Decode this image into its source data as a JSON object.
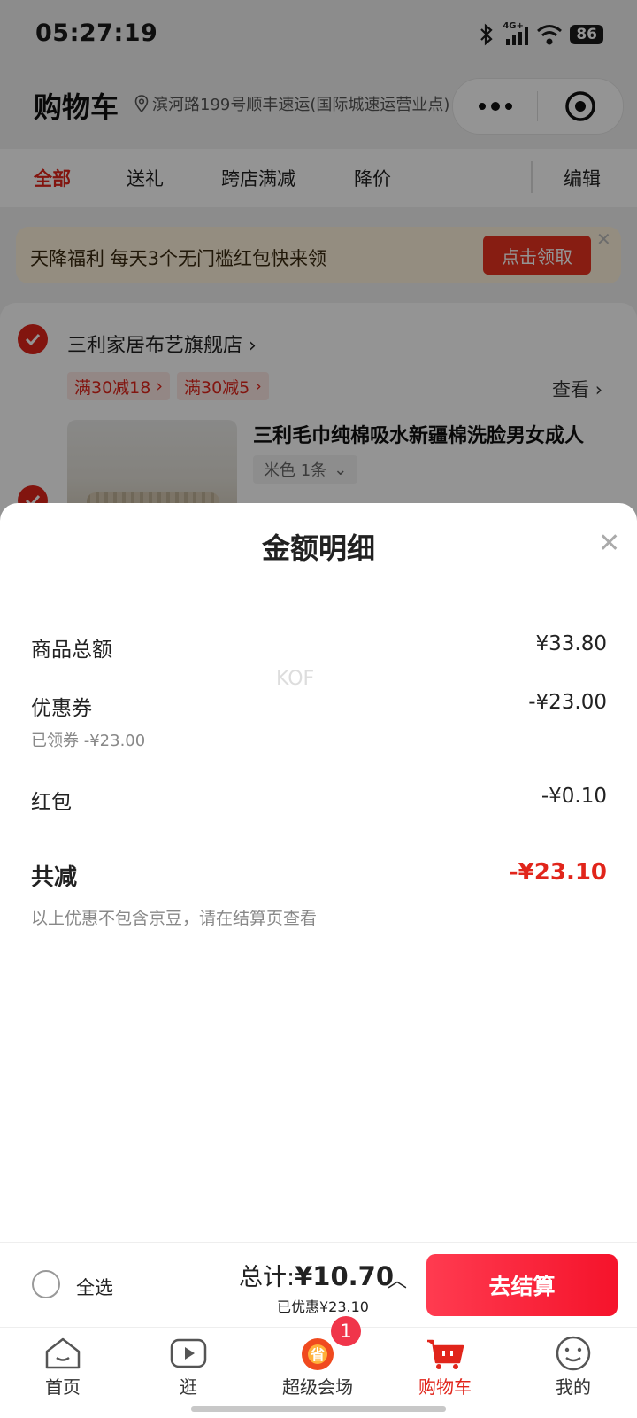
{
  "status_bar": {
    "time": "05:27:19",
    "battery": "86",
    "network": "4G+"
  },
  "header": {
    "title": "购物车",
    "location": "滨河路199号顺丰速运(国际城速运营业点)"
  },
  "tabs": [
    {
      "label": "全部",
      "active": true
    },
    {
      "label": "送礼"
    },
    {
      "label": "跨店满减"
    },
    {
      "label": "降价"
    }
  ],
  "edit_label": "编辑",
  "banner": {
    "text": "天降福利 每天3个无门槛红包快来领",
    "button": "点击领取"
  },
  "shop": {
    "name": "三利家居布艺旗舰店",
    "promos": [
      "满30减18",
      "满30减5"
    ],
    "view": "查看",
    "product": {
      "title": "三利毛巾纯棉吸水新疆棉洗脸男女成人",
      "sku": "米色 1条"
    }
  },
  "sheet": {
    "title": "金额明细",
    "watermark": "KOF",
    "rows": [
      {
        "label": "商品总额",
        "value": "¥33.80"
      },
      {
        "label": "优惠券",
        "value": "-¥23.00",
        "sub": "已领券 -¥23.00"
      },
      {
        "label": "红包",
        "value": "-¥0.10"
      }
    ],
    "total_label": "共减",
    "total_value": "-¥23.10",
    "note": "以上优惠不包含京豆，请在结算页查看"
  },
  "checkout": {
    "select_all": "全选",
    "total_prefix": "总计:",
    "total_amount": "¥10.70",
    "saved": "已优惠¥23.10",
    "button": "去结算"
  },
  "bottom_nav": [
    {
      "label": "首页"
    },
    {
      "label": "逛"
    },
    {
      "label": "超级会场",
      "badge": "1"
    },
    {
      "label": "购物车",
      "active": true
    },
    {
      "label": "我的"
    }
  ],
  "colors": {
    "accent": "#e1251b",
    "checkout_button": "#f5132b"
  }
}
